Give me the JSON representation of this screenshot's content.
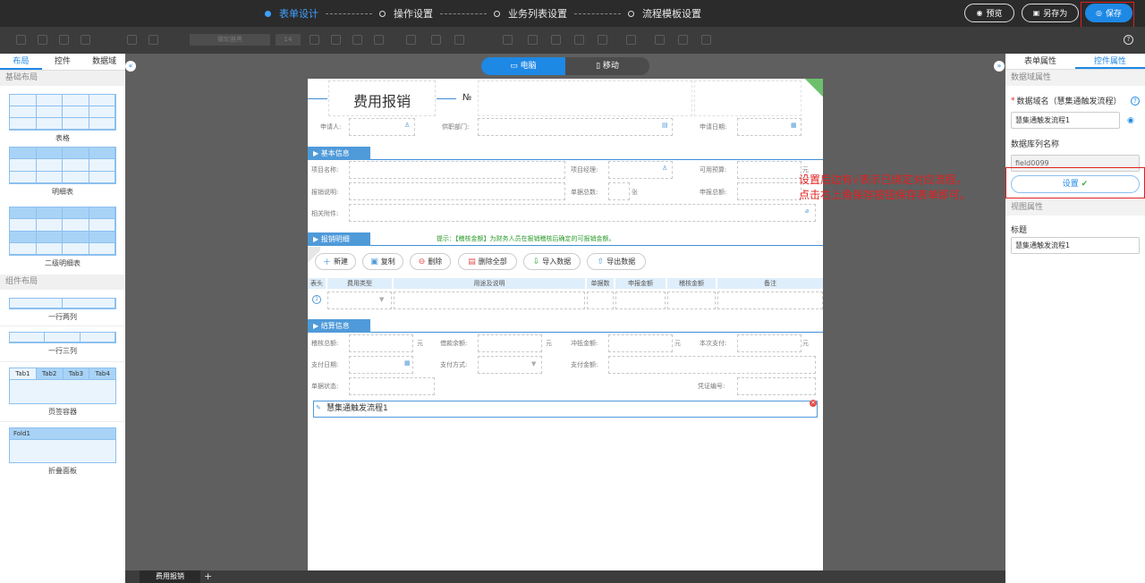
{
  "steps": [
    "表单设计",
    "操作设置",
    "业务列表设置",
    "流程模板设置"
  ],
  "top_buttons": {
    "preview": "预览",
    "save_as": "另存为",
    "save": "保存"
  },
  "toolbar": {
    "font_family": "微软雅黑",
    "font_size": "14"
  },
  "left_panel": {
    "tabs": [
      "布局",
      "控件",
      "数据域"
    ],
    "basic_layout": "基础布局",
    "component_layout": "组件布局",
    "items": {
      "table": "表格",
      "detail": "明细表",
      "detail2": "二级明细表",
      "two_col": "一行两列",
      "three_col": "一行三列",
      "tab_container": "页签容器",
      "fold_panel": "折叠面板"
    },
    "tab_labels": [
      "Tab1",
      "Tab2",
      "Tab3",
      "Tab4"
    ],
    "fold_label": "Fold1"
  },
  "device": {
    "pc": "电脑",
    "mobile": "移动"
  },
  "form": {
    "title": "费用报销",
    "no_label": "№",
    "applicant": "申请人:",
    "dept": "供职部门:",
    "apply_date": "申请日期:",
    "section_basic": "基本信息",
    "project_name": "项目名称:",
    "project_manager": "项目经理:",
    "available_budget": "可用预算:",
    "yuan": "元",
    "reimb_desc": "报销说明:",
    "bill_total": "单据总数:",
    "zhang": "张",
    "apply_total": "申报总额:",
    "attachment": "相关附件:",
    "section_detail": "报销明细",
    "hint": "提示：【稽核金额】为财务人员在报销稽核后确定的可报销金额。",
    "actions": [
      "新建",
      "复制",
      "删除",
      "删除全部",
      "导入数据",
      "导出数据"
    ],
    "columns": [
      "表头",
      "费用类型",
      "用途及说明",
      "单据数",
      "申报金额",
      "稽核金额",
      "备注"
    ],
    "row_no": "1",
    "section_settle": "结算信息",
    "audit_total": "稽核总额:",
    "loan_balance": "借款余额:",
    "offset_amount": "冲抵金额:",
    "this_pay": "本次支付:",
    "pay_date": "支付日期:",
    "pay_method": "支付方式:",
    "pay_amount": "支付金额:",
    "doc_status": "单据状态:",
    "voucher_no": "凭证编号:",
    "process_field": "慧集通触发流程1"
  },
  "annotation": [
    "设置后边有√表示已绑定对应流程，",
    "点击右上角保存按钮保存表单即可。"
  ],
  "right_panel": {
    "tabs": [
      "表单属性",
      "控件属性"
    ],
    "data_attr": "数据域属性",
    "data_domain_label": "数据域名（慧集通触发流程）",
    "data_domain_value": "慧集通触发流程1",
    "db_col_label": "数据库列名称",
    "db_col_value": "field0099",
    "settings_btn": "设置",
    "view_attr": "视图属性",
    "title_label": "标题",
    "title_value": "慧集通触发流程1"
  },
  "bottom_tab": "费用报销",
  "colors": {
    "accent": "#1e88e5",
    "highlight": "#e02020",
    "section": "#4f9ad9"
  }
}
